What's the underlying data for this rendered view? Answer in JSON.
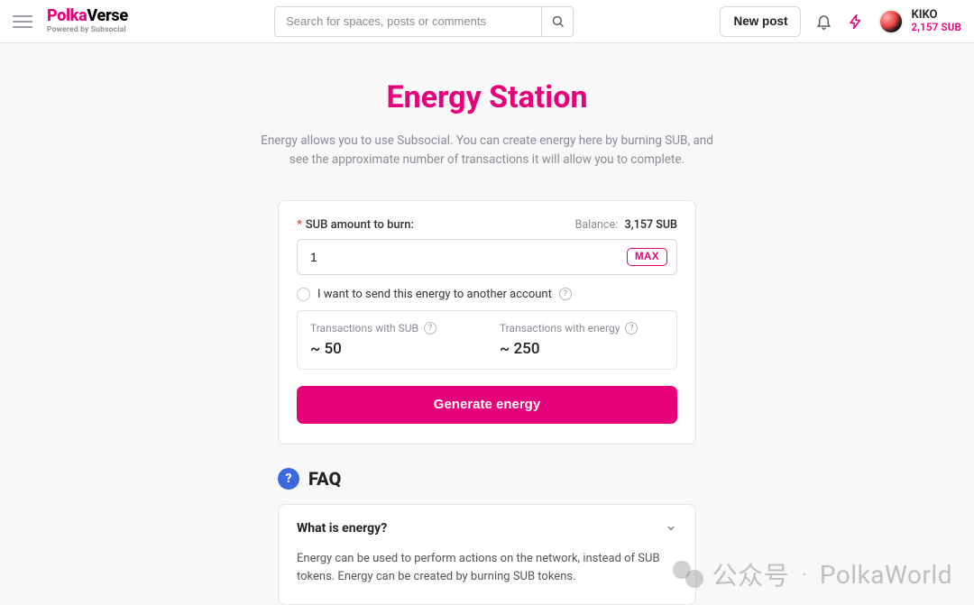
{
  "header": {
    "logo_main_left": "Polka",
    "logo_main_right": "Verse",
    "logo_sub": "Powered by Subsocial",
    "search_placeholder": "Search for spaces, posts or comments",
    "new_post_label": "New post",
    "user_name": "KIKO",
    "user_balance": "2,157 SUB"
  },
  "page": {
    "title": "Energy Station",
    "desc_line1": "Energy allows you to use Subsocial. You can create energy here by burning SUB, and",
    "desc_line2": "see the approximate number of transactions it will allow you to complete."
  },
  "form": {
    "amount_label": "SUB amount to burn:",
    "balance_label": "Balance:",
    "balance_value": "3,157 SUB",
    "amount_value": "1",
    "max_label": "MAX",
    "send_other_label": "I want to send this energy to another account",
    "stat_sub_label": "Transactions with SUB",
    "stat_sub_value": "~ 50",
    "stat_energy_label": "Transactions with energy",
    "stat_energy_value": "~ 250",
    "generate_label": "Generate energy"
  },
  "faq": {
    "section_title": "FAQ",
    "q1": "What is energy?",
    "a1": "Energy can be used to perform actions on the network, instead of SUB tokens. Energy can be created by burning SUB tokens."
  },
  "watermark": {
    "label_left": "公众号",
    "label_right": "PolkaWorld"
  }
}
